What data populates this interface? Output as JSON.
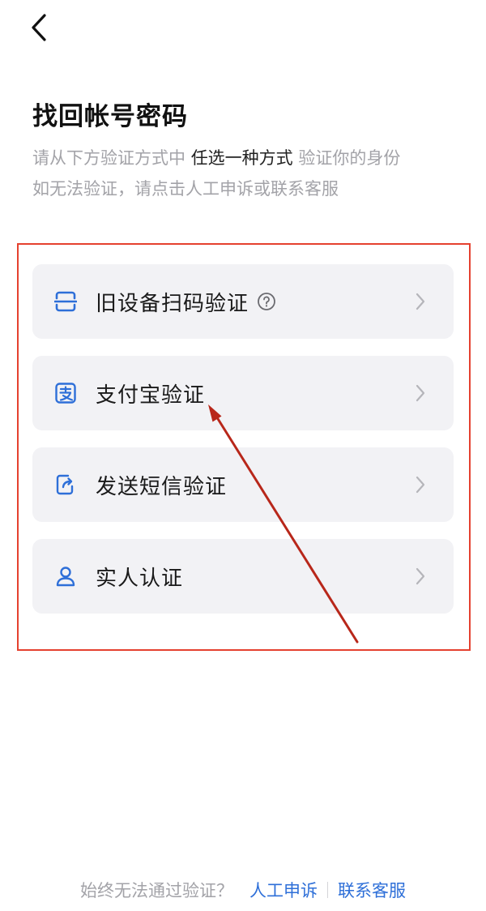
{
  "header": {
    "back_icon": "chevron-left-icon"
  },
  "title": "找回帐号密码",
  "subtitle": {
    "line1_pre": "请从下方验证方式中 ",
    "line1_highlight": "任选一种方式",
    "line1_post": " 验证你的身份",
    "line2": "如无法验证，请点击人工申诉或联系客服"
  },
  "options": [
    {
      "label": "旧设备扫码验证",
      "icon": "scan-icon",
      "has_help": true
    },
    {
      "label": "支付宝验证",
      "icon": "alipay-icon",
      "has_help": false
    },
    {
      "label": "发送短信验证",
      "icon": "sms-icon",
      "has_help": false
    },
    {
      "label": "实人认证",
      "icon": "person-icon",
      "has_help": false
    }
  ],
  "footer": {
    "question": "始终无法通过验证？",
    "appeal_link": "人工申诉",
    "contact_link": "联系客服"
  },
  "colors": {
    "accent": "#2e6fd8",
    "option_bg": "#f2f2f5",
    "annotation_red": "#e5412f",
    "muted_text": "#a3a3a8"
  }
}
